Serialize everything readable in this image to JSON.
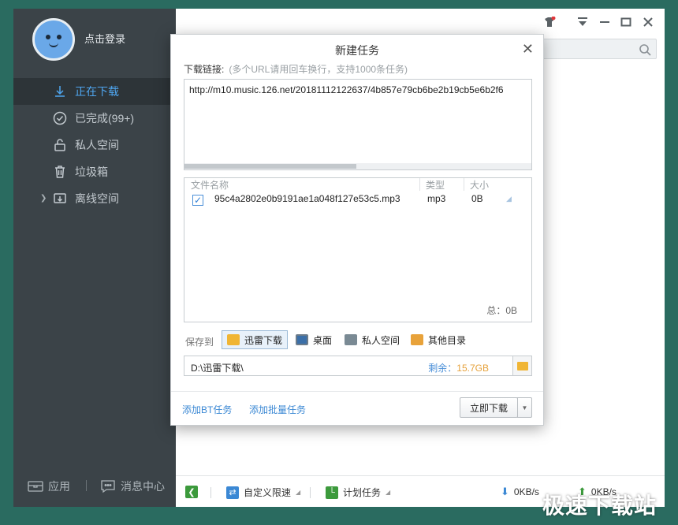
{
  "sidebar": {
    "login_label": "点击登录",
    "items": [
      {
        "label": "正在下载",
        "icon": "download-icon"
      },
      {
        "label": "已完成(99+)",
        "icon": "check-circle-icon"
      },
      {
        "label": "私人空间",
        "icon": "lock-icon"
      },
      {
        "label": "垃圾箱",
        "icon": "trash-icon"
      },
      {
        "label": "离线空间",
        "icon": "cloud-download-icon"
      }
    ],
    "bottom": {
      "apps_label": "应用",
      "messages_label": "消息中心"
    }
  },
  "statusbar": {
    "limit_label": "自定义限速",
    "schedule_label": "计划任务",
    "down_speed": "0KB/s",
    "up_speed": "0KB/s"
  },
  "dialog": {
    "title": "新建任务",
    "link_label": "下载链接:",
    "link_hint": "(多个URL请用回车换行，支持1000条任务)",
    "url_value": "http://m10.music.126.net/20181112122637/4b857e79cb6be2b19cb5e6b2f6",
    "file_table": {
      "headers": {
        "name": "文件名称",
        "type": "类型",
        "size": "大小"
      },
      "rows": [
        {
          "checked": true,
          "name": "95c4a2802e0b9191ae1a048f127e53c5.mp3",
          "type": "mp3",
          "size": "0B"
        }
      ],
      "total": "总：0B"
    },
    "save_to_label": "保存到",
    "save_options": [
      "迅雷下载",
      "桌面",
      "私人空间",
      "其他目录"
    ],
    "selected_option": "迅雷下载",
    "path_value": "D:\\迅雷下载\\",
    "free_label": "剩余：",
    "free_value": "15.7GB",
    "add_bt_label": "添加BT任务",
    "add_batch_label": "添加批量任务",
    "download_now_label": "立即下载"
  },
  "watermark": "极速下载站",
  "colors": {
    "accent": "#4fa6f0",
    "sidebar_bg": "#3b4348",
    "link": "#3b88d4",
    "desktop_bg": "#2a6b60"
  }
}
